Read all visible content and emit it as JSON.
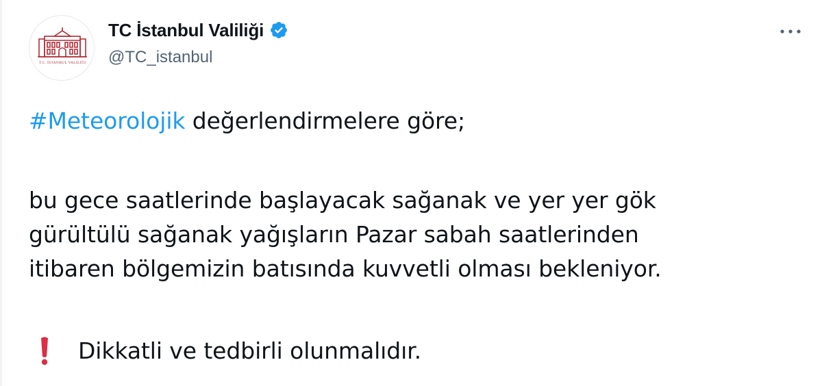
{
  "author": {
    "display_name": "TC İstanbul Valiliği",
    "handle": "@TC_istanbul",
    "verified": true,
    "avatar_icon": "governorship-building-logo",
    "avatar_caption": "T.C. İSTANBUL VALİLİĞİ"
  },
  "menu": {
    "icon": "more-horizontal-icon"
  },
  "tweet": {
    "hashtag": "#Meteorolojik",
    "line1_rest": " değerlendirmelere göre;",
    "body_lines": [
      "bu gece saatlerinde başlayacak sağanak ve yer yer gök",
      "gürültülü sağanak yağışların Pazar sabah saatlerinden",
      "itibaren bölgemizin batısında kuvvetli olması bekleniyor."
    ],
    "warning_icon": "red-exclamation-icon",
    "warning_text": "Dikkatli ve tedbirli olunmalıdır."
  },
  "colors": {
    "link": "#1d9bf0",
    "text": "#0f1419",
    "secondary": "#536471",
    "verified": "#1d9bf0",
    "logo": "#b22c36",
    "warning": "#dd2e44"
  }
}
